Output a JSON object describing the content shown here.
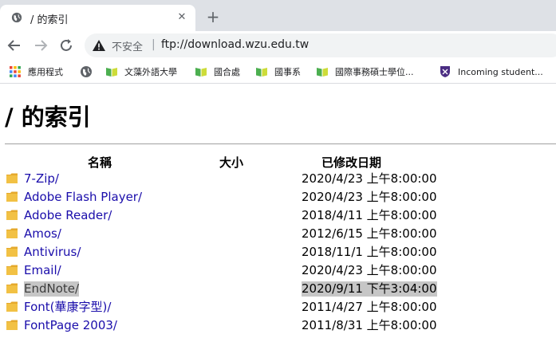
{
  "tab": {
    "title": "/ 的索引",
    "favicon": "globe-icon",
    "close_glyph": "✕"
  },
  "newtab_glyph": "+",
  "address": {
    "security_text": "不安全",
    "separator": "|",
    "url": "ftp://download.wzu.edu.tw"
  },
  "bookmarks": [
    {
      "label": "應用程式",
      "icon": "apps-grid-icon"
    },
    {
      "label": "",
      "icon": "globe-icon"
    },
    {
      "label": "文藻外語大學",
      "icon": "book-icon"
    },
    {
      "label": "國合處",
      "icon": "book-icon"
    },
    {
      "label": "國事系",
      "icon": "book-icon"
    },
    {
      "label": "國際事務碩士學位...",
      "icon": "book-icon"
    },
    {
      "label": "Incoming student...",
      "icon": "shield-icon"
    }
  ],
  "page": {
    "heading": "/ 的索引",
    "columns": {
      "name": "名稱",
      "size": "大小",
      "modified": "已修改日期"
    },
    "rows": [
      {
        "name": "7-Zip/",
        "modified": "2020/4/23 上午8:00:00"
      },
      {
        "name": "Adobe Flash Player/",
        "modified": "2020/4/23 上午8:00:00"
      },
      {
        "name": "Adobe Reader/",
        "modified": "2018/4/11 上午8:00:00"
      },
      {
        "name": "Amos/",
        "modified": "2012/6/15 上午8:00:00"
      },
      {
        "name": "Antivirus/",
        "modified": "2018/11/1 上午8:00:00"
      },
      {
        "name": "Email/",
        "modified": "2020/4/23 上午8:00:00"
      },
      {
        "name": "EndNote/",
        "modified": "2020/9/11 下午3:04:00",
        "selected": true
      },
      {
        "name": "Font(華康字型)/",
        "modified": "2011/4/27 上午8:00:00"
      },
      {
        "name": "FontPage 2003/",
        "modified": "2011/8/31 上午8:00:00"
      }
    ]
  },
  "colors": {
    "tab_strip": "#dee1e6",
    "omnibox": "#f1f3f4",
    "link": "#1a0dab",
    "folder": "#f2c144",
    "selection": "#c6c6c6"
  }
}
